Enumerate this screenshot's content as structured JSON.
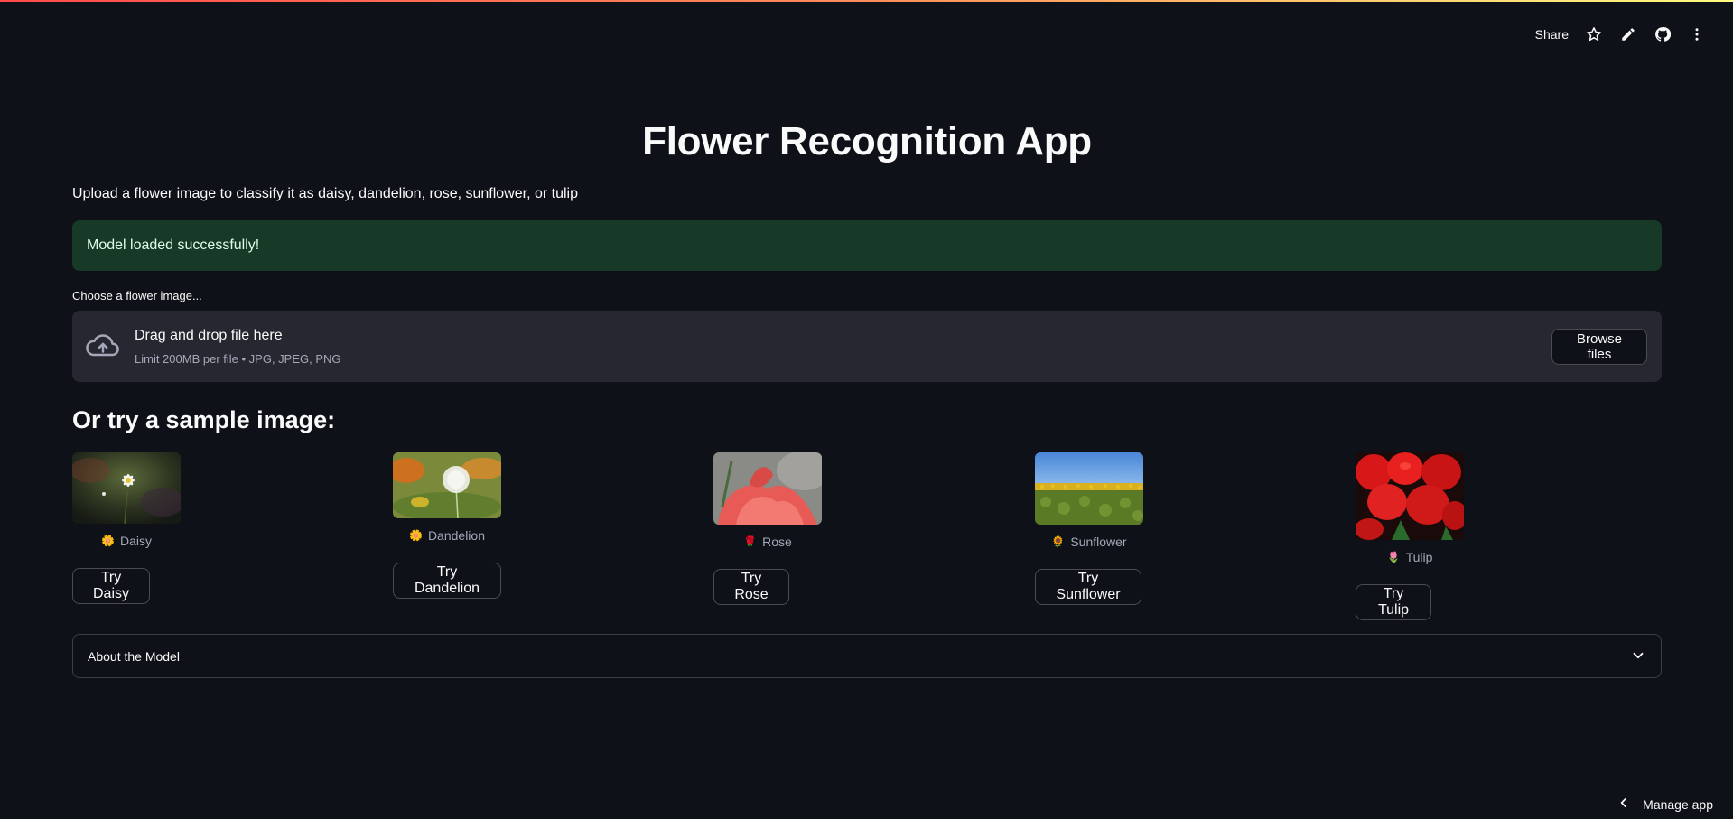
{
  "toolbar": {
    "share_label": "Share",
    "icons": [
      "star-icon",
      "pencil-icon",
      "github-icon",
      "more-vertical-icon"
    ]
  },
  "page": {
    "title": "Flower Recognition App",
    "subtitle": "Upload a flower image to classify it as daisy, dandelion, rose, sunflower, or tulip"
  },
  "alert": {
    "text": "Model loaded successfully!",
    "color": "#173928"
  },
  "uploader": {
    "label": "Choose a flower image...",
    "drag_text": "Drag and drop file here",
    "limit_text": "Limit 200MB per file • JPG, JPEG, PNG",
    "browse_label": "Browse files"
  },
  "samples": {
    "heading": "Or try a sample image:",
    "items": [
      {
        "emoji": "🌼",
        "name": "Daisy",
        "button": "Try Daisy"
      },
      {
        "emoji": "🌼",
        "name": "Dandelion",
        "button": "Try Dandelion"
      },
      {
        "emoji": "🌹",
        "name": "Rose",
        "button": "Try Rose"
      },
      {
        "emoji": "🌻",
        "name": "Sunflower",
        "button": "Try Sunflower"
      },
      {
        "emoji": "🌷",
        "name": "Tulip",
        "button": "Try Tulip"
      }
    ]
  },
  "expander": {
    "label": "About the Model"
  },
  "footer": {
    "manage_label": "Manage app"
  },
  "colors": {
    "background": "#0e1117",
    "text": "#fafafa",
    "secondary_bg": "#262730",
    "success_bg": "#173928"
  }
}
